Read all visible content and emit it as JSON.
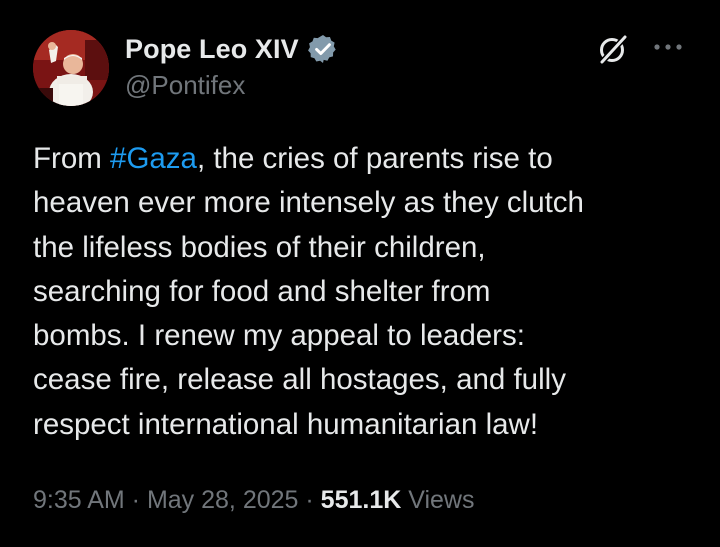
{
  "author": {
    "display_name": "Pope Leo XIV",
    "handle": "@Pontifex",
    "verified": true
  },
  "post": {
    "text_prefix": "From ",
    "hashtag": "#Gaza",
    "text_rest": ", the cries of parents rise to\nheaven ever more intensely as they clutch\nthe lifeless bodies of their children,\nsearching for food and shelter from\nbombs. I renew my appeal to leaders:\ncease fire, release all hostages, and fully\nrespect international humanitarian law!"
  },
  "meta": {
    "time": "9:35 AM",
    "separator": " · ",
    "date": "May 28, 2025",
    "views_count": "551.1K",
    "views_label": " Views"
  },
  "icons": {
    "verified": "verified-badge-icon",
    "grok": "grok-icon",
    "more": "more-options-icon"
  },
  "colors": {
    "background": "#000000",
    "text": "#e7e9ea",
    "muted": "#71767b",
    "link": "#1d9bf0"
  }
}
